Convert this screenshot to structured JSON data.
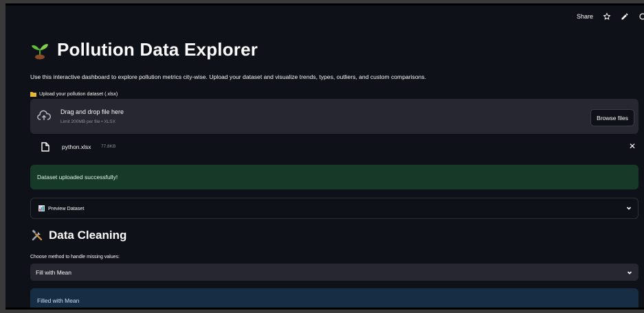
{
  "toolbar": {
    "share_label": "Share",
    "icons": [
      "star-icon",
      "edit-icon",
      "github-icon"
    ]
  },
  "header": {
    "title": "Pollution Data Explorer",
    "title_icon": "seedling-icon",
    "intro": "Use this interactive dashboard to explore pollution metrics city-wise. Upload your dataset and visualize trends, types, outliers, and custom comparisons."
  },
  "uploader": {
    "label": "Upload your pollution dataset (.xlsx)",
    "label_icon": "folder-icon",
    "dropzone_title": "Drag and drop file here",
    "dropzone_subtitle": "Limit 200MB per file • XLSX",
    "browse_label": "Browse files",
    "file": {
      "name": "python.xlsx",
      "size": "77.8KB"
    }
  },
  "success": {
    "message": "Dataset uploaded successfully!",
    "color": "#173928"
  },
  "expander": {
    "label": "Preview Dataset",
    "icon": "bar-chart-icon"
  },
  "cleaning": {
    "title": "Data Cleaning",
    "icon": "tools-icon",
    "select_label": "Choose method to handle missing values:",
    "selected": "Fill with Mean",
    "info": "Filled with Mean",
    "info_color": "#172d43"
  },
  "colors": {
    "background": "#0e1117",
    "panel": "#262730",
    "text": "#fafafa"
  }
}
